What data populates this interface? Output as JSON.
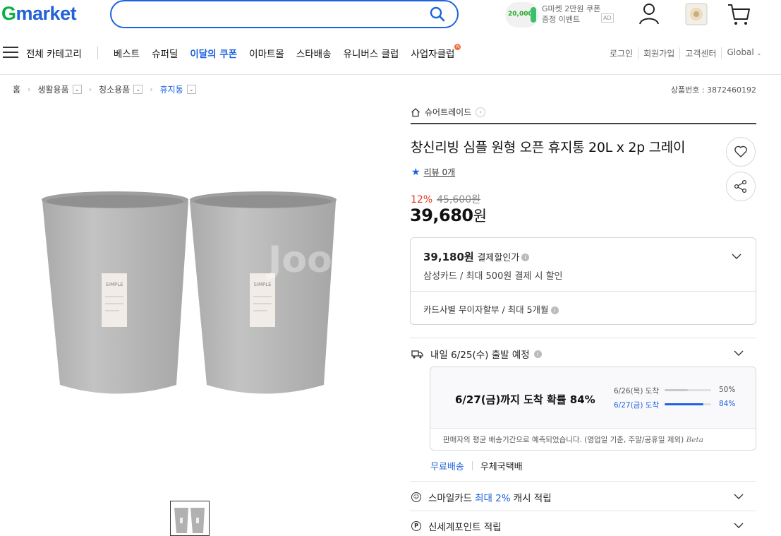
{
  "header": {
    "logo_g": "G",
    "logo_rest": "market",
    "promo_badge": "20,000",
    "promo_line1": "G마켓 2만원 쿠폰",
    "promo_line2": "증정 이벤트",
    "ad_label": "AD"
  },
  "gnb": {
    "all_categories": "전체 카테고리",
    "items": [
      "베스트",
      "슈퍼딜",
      "이달의 쿠폰",
      "이마트몰",
      "스타배송",
      "유니버스 클럽",
      "사업자클럽"
    ],
    "new_badge": "N",
    "util": [
      "로그인",
      "회원가입",
      "고객센터",
      "Global"
    ]
  },
  "breadcrumb": {
    "home": "홈",
    "items": [
      "생활용품",
      "청소용품",
      "휴지통"
    ],
    "product_no": "상품번호 : 3872460192"
  },
  "gallery": {
    "label_brand": "SIMPLE",
    "watermark": "Joo"
  },
  "product": {
    "seller": "슈어트레이드",
    "title": "창신리빙 심플 원형 오픈 휴지통 20L x 2p 그레이",
    "review": "리뷰 0개",
    "discount": "12%",
    "original_price": "45,600원",
    "price": "39,680",
    "price_unit": "원"
  },
  "benefit": {
    "pay_price": "39,180원",
    "pay_label": "결제할인가",
    "pay_detail": "삼성카드 / 최대 500원 결제 시 할인",
    "installment": "카드사별 무이자할부 / 최대 5개월"
  },
  "shipping": {
    "dispatch": "내일 6/25(수) 출발 예정",
    "eta_headline": "6/27(금)까지 도착 확률 84%",
    "rows": [
      {
        "date": "6/26(목) 도착",
        "pct": "50%",
        "value": 0.5
      },
      {
        "date": "6/27(금) 도착",
        "pct": "84%",
        "value": 0.84
      }
    ],
    "note": "판매자의 평균 배송기간으로 예측되었습니다. (영업일 기준, 주말/공휴일 제외)",
    "beta": "Beta",
    "free": "무료배송",
    "carrier": "우체국택배"
  },
  "rewards": {
    "smile_prefix": "스마일카드",
    "smile_highlight": "최대 2%",
    "smile_suffix": "캐시 적립",
    "shinsegae": "신세계포인트 적립",
    "smile_icon": "☺",
    "point_icon": "P"
  },
  "colors": {
    "brand_green": "#06b043",
    "brand_blue": "#1d63df",
    "sale_red": "#e8381d"
  }
}
